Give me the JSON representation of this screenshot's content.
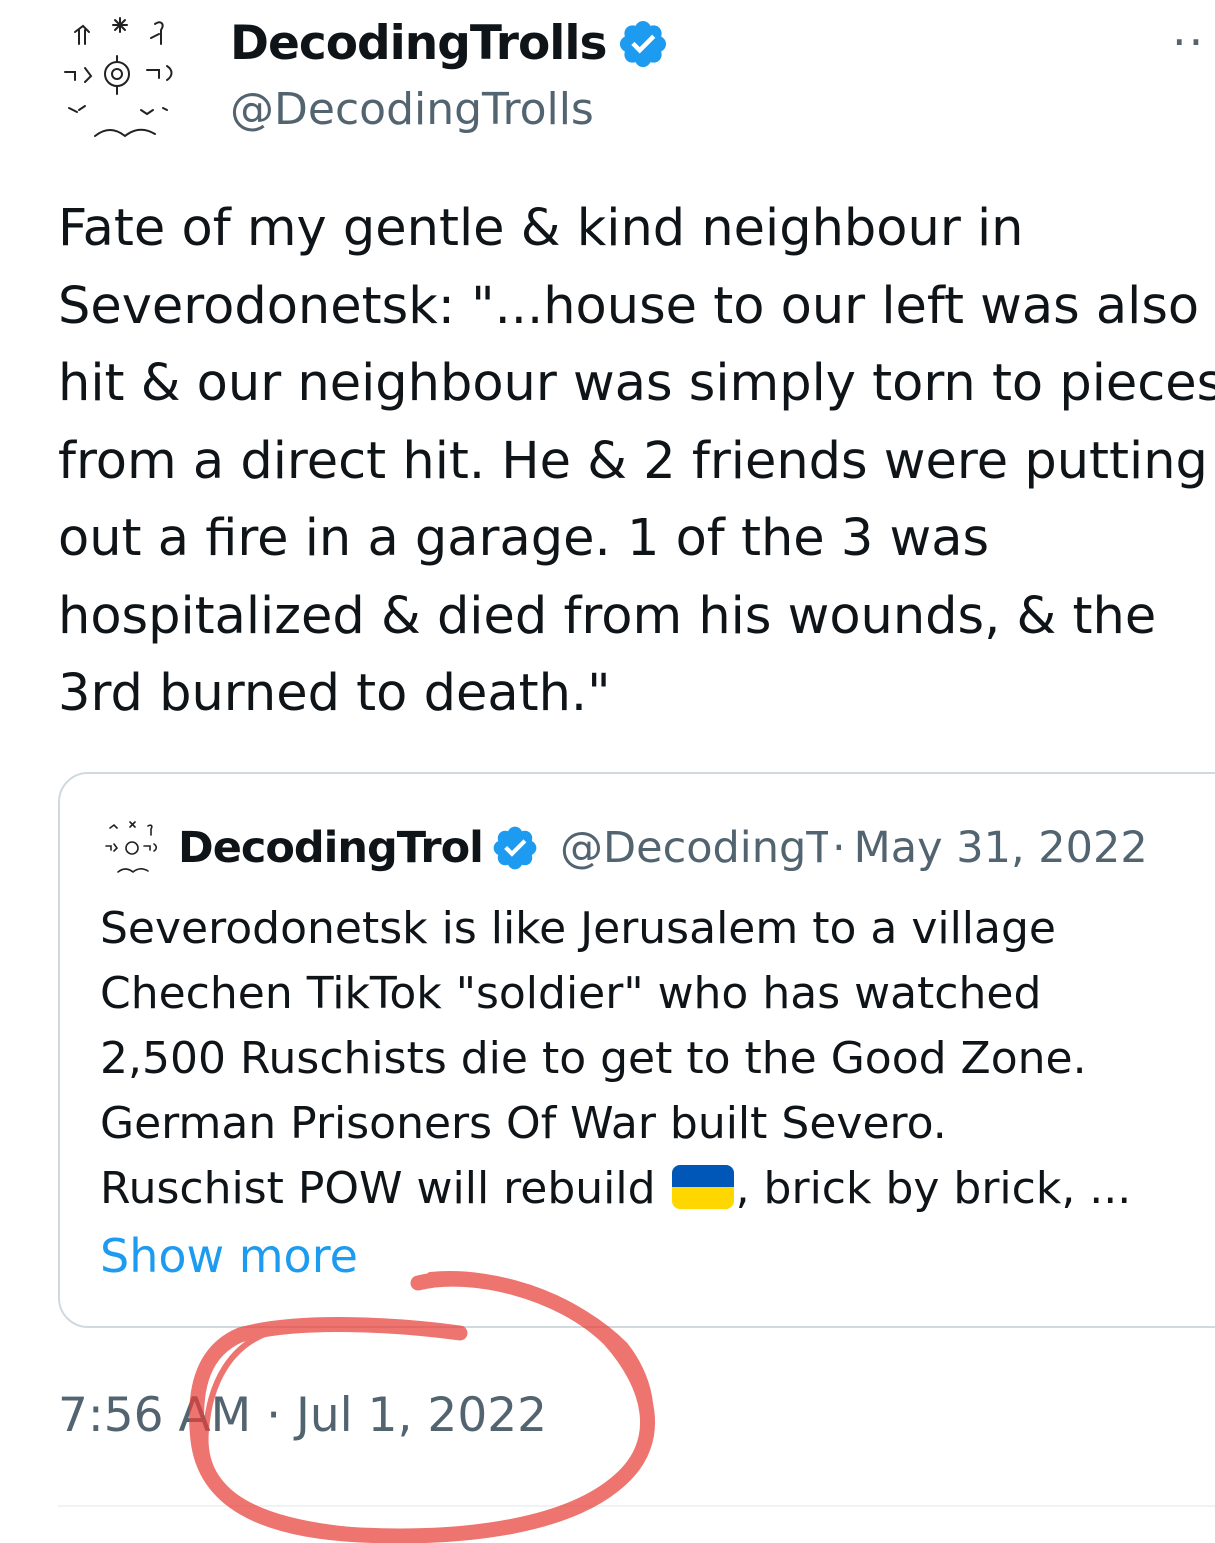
{
  "author": {
    "display_name": "DecodingTrolls",
    "handle": "@DecodingTrolls"
  },
  "menu": {
    "more_label": "··"
  },
  "tweet": {
    "lines": [
      "Fate of my gentle & kind neighbour in",
      "Severodonetsk: \"...house to our left was also",
      "hit & our neighbour was simply torn to pieces",
      "from a direct hit. He & 2 friends were putting",
      "out a fire in a garage. 1 of the 3 was",
      "hospitalized & died from his wounds, & the",
      "3rd burned to death.\""
    ],
    "timestamp": "7:56 AM · Jul 1, 2022"
  },
  "quoted": {
    "display_name": "DecodingTrolls",
    "handle": "@DecodingTrolls",
    "separator": "·",
    "date": "May 31, 2022",
    "lines": [
      "Severodonetsk is like Jerusalem to a village",
      "Chechen TikTok \"soldier\" who has watched",
      "2,500 Ruschists die to get to the Good Zone.",
      "German Prisoners Of War built Severo."
    ],
    "last_line_before_flag": "Ruschist POW will rebuild",
    "last_line_after_flag": ", brick by brick, ...",
    "show_more": "Show more"
  },
  "colors": {
    "verified": "#1d9bf0",
    "link": "#1d9bf0",
    "secondary_text": "#536471",
    "annotation": "#e8403a",
    "flag_blue": "#0057b7",
    "flag_yellow": "#ffd700"
  },
  "icons": {
    "verified": "verified-badge-icon",
    "more": "more-options-icon",
    "flag": "ukraine-flag-emoji"
  }
}
